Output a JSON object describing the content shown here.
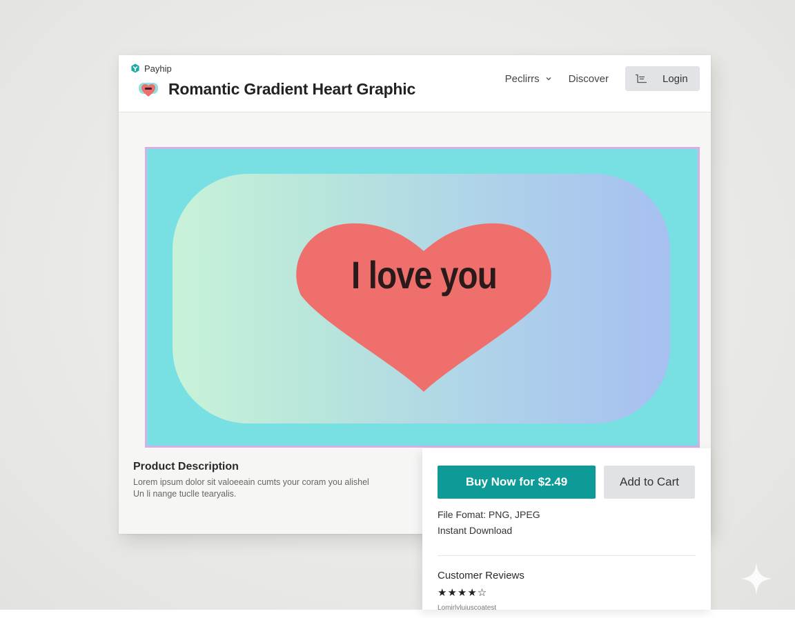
{
  "brand": {
    "name": "Payhip"
  },
  "header": {
    "title": "Romantic Gradient Heart Graphic",
    "nav": {
      "products_label": "Peclirrs",
      "discover_label": "Discover",
      "login_label": "Login"
    }
  },
  "product_image": {
    "heart_text": "I love you",
    "colors": {
      "background": "#78dfe3",
      "border": "#d4b0e6",
      "gradient_start": "#c8f2d8",
      "gradient_end": "#a6c0f0",
      "heart": "#ef6f6c"
    }
  },
  "description": {
    "heading": "Product Description",
    "line1": "Lorem ipsum dolor sit valoeeain cumts your coram you alishel",
    "line2": "Un li nange tuclle tearyalis."
  },
  "purchase": {
    "buy_label": "Buy Now for $2.49",
    "cart_label": "Add to Cart",
    "file_format": "File Fomat: PNG, JPEG",
    "instant_download": "Instant Download",
    "reviews_heading": "Customer Reviews",
    "stars": "★★★★☆",
    "rating": 4,
    "rating_max": 5,
    "review_snippet": "Lomirlyluiuscoatest"
  },
  "colors": {
    "accent": "#0e9a96",
    "secondary_button": "#e0e2e5"
  }
}
